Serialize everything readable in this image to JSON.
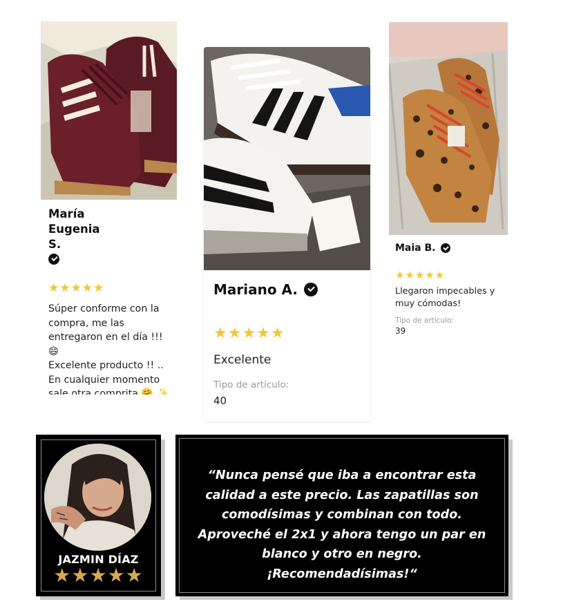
{
  "reviews": [
    {
      "name": "María Eugenia S.",
      "stars": "★★★★★",
      "text": "Súper conforme con la compra, me las entregaron en el día !!! 😄\nExcelente producto !! .. En cualquier momento sale otra comprita 🤗 ✨"
    },
    {
      "name": "Mariano A.",
      "stars": "★★★★★",
      "text": "Excelente",
      "type_label": "Tipo de artículo:",
      "type_value": "40"
    },
    {
      "name": "Maia B.",
      "stars": "★★★★★",
      "text": "Llegaron impecables y muy cómodas!",
      "type_label": "Tipo de artículo:",
      "type_value": "39"
    }
  ],
  "testimonial": {
    "name": "JAZMIN DÍAZ",
    "stars": "★★★★★",
    "quote": "“Nunca pensé que iba a encontrar esta calidad a este precio. Las zapatillas son comodísimas y combinan con todo. Aproveché el 2x1 y ahora tengo un par en blanco y otro en negro. ¡Recomendadísimas!“"
  },
  "colors": {
    "star_yellow": "#f3c63a",
    "star_gold": "#d7a94e",
    "box_black": "#000000"
  },
  "icons": [
    "verified-badge-icon",
    "star-icon"
  ]
}
